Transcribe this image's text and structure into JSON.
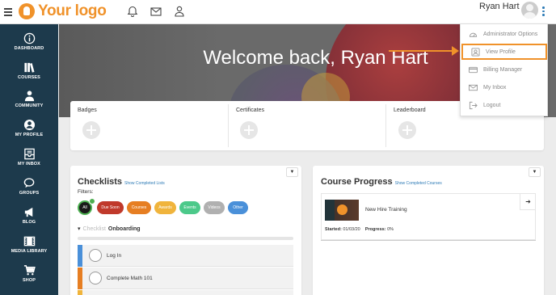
{
  "header": {
    "logo_text": "Your logo",
    "user_name": "Ryan Hart"
  },
  "sidebar": {
    "items": [
      {
        "label": "DASHBOARD",
        "icon": "info-icon"
      },
      {
        "label": "COURSES",
        "icon": "books-icon"
      },
      {
        "label": "COMMUNITY",
        "icon": "community-icon"
      },
      {
        "label": "MY PROFILE",
        "icon": "user-icon"
      },
      {
        "label": "MY INBOX",
        "icon": "inbox-icon"
      },
      {
        "label": "GROUPS",
        "icon": "chat-icon"
      },
      {
        "label": "BLOG",
        "icon": "megaphone-icon"
      },
      {
        "label": "MEDIA LIBRARY",
        "icon": "film-icon"
      },
      {
        "label": "SHOP",
        "icon": "cart-icon"
      }
    ]
  },
  "hero": {
    "title": "Welcome back, Ryan Hart"
  },
  "dropdown": {
    "items": [
      {
        "label": "Administrator Options",
        "icon": "gauge-icon"
      },
      {
        "label": "View Profile",
        "icon": "profile-icon",
        "highlighted": true
      },
      {
        "label": "Billing Manager",
        "icon": "card-icon"
      },
      {
        "label": "My Inbox",
        "icon": "mail-icon"
      },
      {
        "label": "Logout",
        "icon": "logout-icon"
      }
    ]
  },
  "achievements": {
    "badges_label": "Badges",
    "certificates_label": "Certificates",
    "leaderboard_label": "Leaderboard"
  },
  "checklists": {
    "title": "Checklists",
    "show_completed": "Show Completed Lists",
    "filters_label": "Filters:",
    "filters": [
      {
        "label": "All",
        "color": "#1a1a1a"
      },
      {
        "label": "Due Soon",
        "color": "#c0392b"
      },
      {
        "label": "Courses",
        "color": "#e67e22"
      },
      {
        "label": "Awards",
        "color": "#f0b43c"
      },
      {
        "label": "Events",
        "color": "#4cc98a"
      },
      {
        "label": "Videos",
        "color": "#b0b0b0"
      },
      {
        "label": "Other",
        "color": "#4a90d9"
      }
    ],
    "checklist_word": "Checklist",
    "checklist_name": "Onboarding",
    "tasks": [
      {
        "label": "Log In",
        "color": "#4a90d9"
      },
      {
        "label": "Complete Math 101",
        "color": "#e67e22"
      }
    ]
  },
  "course_progress": {
    "title": "Course Progress",
    "show_completed": "Show Completed Courses",
    "course_name": "New Hire Training",
    "started_label": "Started:",
    "started_value": "01/03/20",
    "progress_label": "Progress:",
    "progress_value": "0%"
  },
  "colors": {
    "accent": "#f0922a",
    "sidebar_bg": "#1d3a4c",
    "link": "#2e7bb6"
  }
}
